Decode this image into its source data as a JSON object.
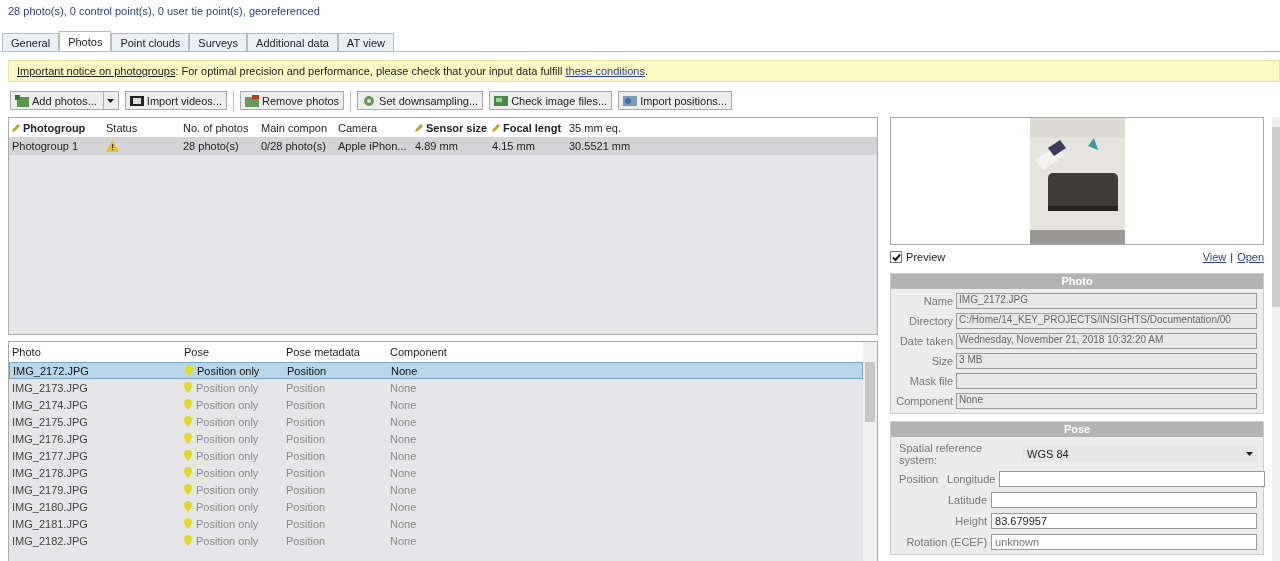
{
  "summary": "28 photo(s), 0 control point(s), 0 user tie point(s), georeferenced",
  "tabs": [
    {
      "label": "General",
      "selected": false
    },
    {
      "label": "Photos",
      "selected": true
    },
    {
      "label": "Point clouds",
      "selected": false
    },
    {
      "label": "Surveys",
      "selected": false
    },
    {
      "label": "Additional data",
      "selected": false
    },
    {
      "label": "AT view",
      "selected": false
    }
  ],
  "notice": {
    "link": "Important notice on photogroups",
    "text": ": For optimal precision and performance, please check that your input data fulfill ",
    "link2": "these conditions",
    "end": "."
  },
  "toolbar": [
    {
      "label": "Add photos...",
      "kind": "split"
    },
    {
      "label": "Import videos...",
      "kind": "button"
    },
    {
      "label": "Remove photos",
      "kind": "button"
    },
    {
      "label": "Set downsampling...",
      "kind": "button"
    },
    {
      "label": "Check image files...",
      "kind": "button"
    },
    {
      "label": "Import positions...",
      "kind": "button"
    }
  ],
  "photogroups": {
    "columns": [
      {
        "label": "Photogroup",
        "editable": true
      },
      {
        "label": "Status",
        "editable": false
      },
      {
        "label": "No. of photos",
        "editable": false
      },
      {
        "label": "Main compon",
        "editable": false
      },
      {
        "label": "Camera",
        "editable": false
      },
      {
        "label": "Sensor size",
        "editable": true
      },
      {
        "label": "Focal lengt",
        "editable": true
      },
      {
        "label": "35 mm eq.",
        "editable": false
      }
    ],
    "rows": [
      {
        "selected": true,
        "warning": true,
        "cells": [
          "Photogroup 1",
          "",
          "28 photo(s)",
          "0/28 photo(s)",
          "Apple iPhon...",
          "4.89 mm",
          "4.15 mm",
          "30.5521 mm"
        ]
      }
    ]
  },
  "photos": {
    "columns": [
      "Photo",
      "Pose",
      "Pose metadata",
      "Component"
    ],
    "rows": [
      {
        "photo": "IMG_2172.JPG",
        "pose": "Position only",
        "metadata": "Position",
        "component": "None",
        "selected": true
      },
      {
        "photo": "IMG_2173.JPG",
        "pose": "Position only",
        "metadata": "Position",
        "component": "None",
        "selected": false
      },
      {
        "photo": "IMG_2174.JPG",
        "pose": "Position only",
        "metadata": "Position",
        "component": "None",
        "selected": false
      },
      {
        "photo": "IMG_2175.JPG",
        "pose": "Position only",
        "metadata": "Position",
        "component": "None",
        "selected": false
      },
      {
        "photo": "IMG_2176.JPG",
        "pose": "Position only",
        "metadata": "Position",
        "component": "None",
        "selected": false
      },
      {
        "photo": "IMG_2177.JPG",
        "pose": "Position only",
        "metadata": "Position",
        "component": "None",
        "selected": false
      },
      {
        "photo": "IMG_2178.JPG",
        "pose": "Position only",
        "metadata": "Position",
        "component": "None",
        "selected": false
      },
      {
        "photo": "IMG_2179.JPG",
        "pose": "Position only",
        "metadata": "Position",
        "component": "None",
        "selected": false
      },
      {
        "photo": "IMG_2180.JPG",
        "pose": "Position only",
        "metadata": "Position",
        "component": "None",
        "selected": false
      },
      {
        "photo": "IMG_2181.JPG",
        "pose": "Position only",
        "metadata": "Position",
        "component": "None",
        "selected": false
      },
      {
        "photo": "IMG_2182.JPG",
        "pose": "Position only",
        "metadata": "Position",
        "component": "None",
        "selected": false
      }
    ]
  },
  "preview": {
    "checked": true,
    "label": "Preview",
    "links": [
      "View",
      "Open"
    ],
    "separator": "|"
  },
  "photo_section": {
    "title": "Photo",
    "fields": [
      {
        "label": "Name",
        "value": "IMG_2172.JPG"
      },
      {
        "label": "Directory",
        "value": "C:/Home/14_KEY_PROJECTS/INSIGHTS/Documentation/00"
      },
      {
        "label": "Date taken",
        "value": "Wednesday, November 21, 2018 10:32:20 AM"
      },
      {
        "label": "Size",
        "value": "3 MB"
      },
      {
        "label": "Mask file"
      },
      {
        "label": "Component",
        "value": "None"
      }
    ]
  },
  "pose_section": {
    "title": "Pose",
    "srs_label": "Spatial reference system:",
    "srs_value": "WGS 84",
    "position_label": "Position",
    "fields": [
      {
        "label": "Longitude"
      },
      {
        "label": "Latitude"
      },
      {
        "label": "Height",
        "value": "83.679957"
      },
      {
        "label": "Rotation (ECEF)",
        "placeholder": "unknown"
      }
    ]
  }
}
